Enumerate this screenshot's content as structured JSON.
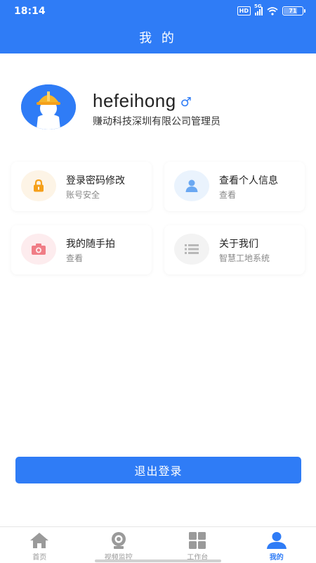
{
  "status_bar": {
    "time": "18:14",
    "network": "5G",
    "hd": "HD",
    "battery": "71"
  },
  "header": {
    "title": "我 的"
  },
  "profile": {
    "username": "hefeihong",
    "gender_symbol": "♂",
    "company": "赚动科技深圳有限公司管理员"
  },
  "cards": [
    {
      "title": "登录密码修改",
      "subtitle": "账号安全",
      "icon": "lock-icon",
      "color": "#f5a01a"
    },
    {
      "title": "查看个人信息",
      "subtitle": "查看",
      "icon": "person-icon",
      "color": "#6aa8f2"
    },
    {
      "title": "我的随手拍",
      "subtitle": "查看",
      "icon": "camera-icon",
      "color": "#f07d86"
    },
    {
      "title": "关于我们",
      "subtitle": "智慧工地系统",
      "icon": "list-icon",
      "color": "#b8b8b8"
    }
  ],
  "logout": {
    "label": "退出登录"
  },
  "tabs": [
    {
      "label": "首页",
      "icon": "home-icon"
    },
    {
      "label": "视频监控",
      "icon": "webcam-icon"
    },
    {
      "label": "工作台",
      "icon": "grid-icon"
    },
    {
      "label": "我的",
      "icon": "user-icon"
    }
  ],
  "colors": {
    "primary": "#2f7cf6"
  }
}
